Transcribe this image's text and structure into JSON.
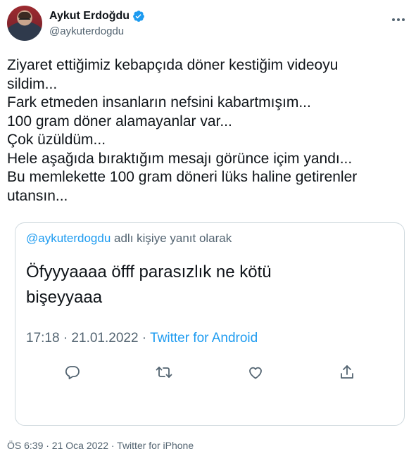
{
  "author": {
    "name": "Aykut Erdoğdu",
    "handle": "@aykuterdogdu"
  },
  "icons": {
    "verified": "verified-badge-icon",
    "more": "more-options-icon",
    "reply": "reply-icon",
    "retweet": "retweet-icon",
    "like": "heart-icon",
    "share": "share-icon"
  },
  "colors": {
    "accent": "#1d9bf0",
    "muted": "#536471",
    "text": "#0f1419",
    "border": "#cfd9de"
  },
  "tweet": {
    "lines": [
      "Ziyaret ettiğimiz kebapçıda döner kestiğim videoyu",
      "sildim...",
      "Fark etmeden insanların nefsini kabartmışım...",
      "100 gram döner alamayanlar var...",
      "Çok üzüldüm...",
      "Hele aşağıda bıraktığım mesajı görünce içim yandı...",
      "Bu memlekette 100 gram döneri lüks haline getirenler",
      "utansın..."
    ],
    "footer": "ÖS 6:39 · 21 Oca 2022 · Twitter for iPhone"
  },
  "quote": {
    "mention": "@aykuterdogdu",
    "reply_suffix": " adlı kişiye yanıt olarak",
    "lines": [
      "Öfyyyaaaa öfff parasızlık ne kötü",
      "bişeyyaaa"
    ],
    "time": "17:18 · 21.01.2022 · ",
    "source": "Twitter for Android"
  }
}
